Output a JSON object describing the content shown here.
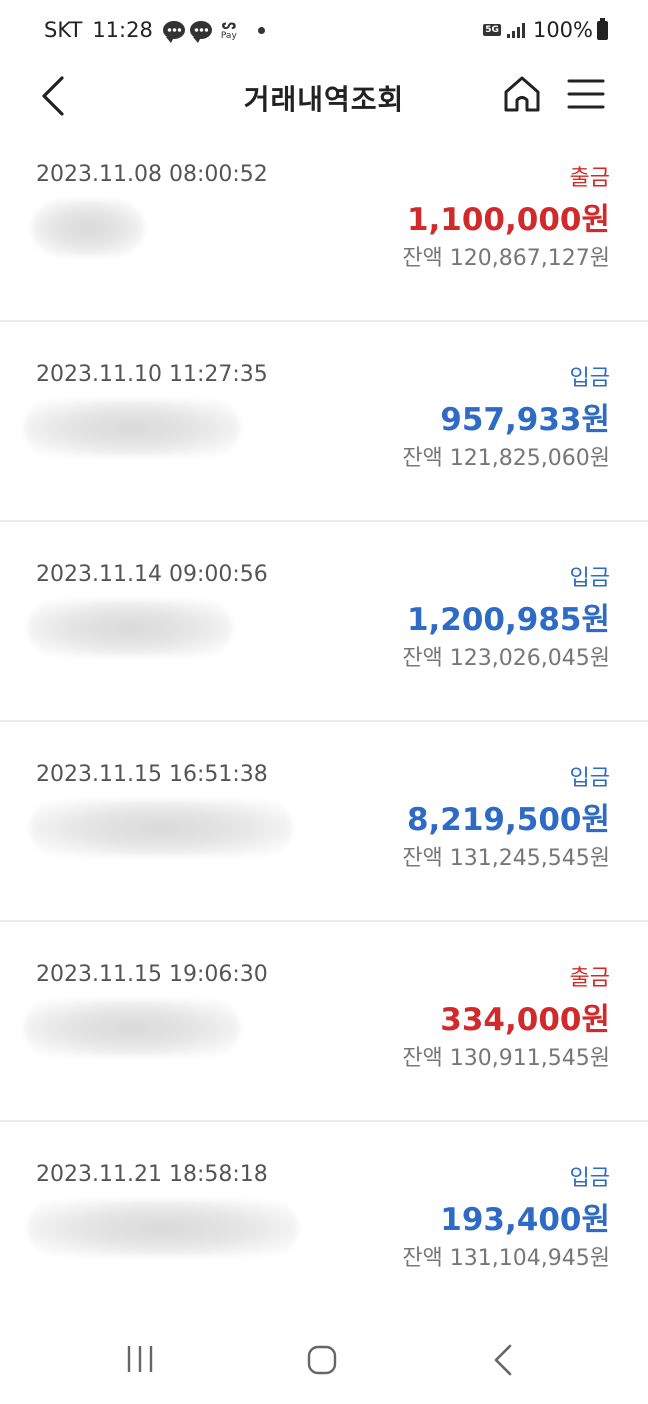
{
  "status_bar": {
    "carrier": "SKT",
    "time": "11:28",
    "pay_label": "Pay",
    "network": "5G",
    "battery": "100%"
  },
  "header": {
    "title": "거래내역조회"
  },
  "icons": {
    "back": "chevron-left-icon",
    "home": "home-icon",
    "menu": "hamburger-menu-icon"
  },
  "colors": {
    "withdrawal": "#d22a2a",
    "deposit": "#2e6bc4"
  },
  "transactions": [
    {
      "datetime": "2023.11.08 08:00:52",
      "type": "출금",
      "amount": "1,100,000원",
      "balance": "잔액 120,867,127원"
    },
    {
      "datetime": "2023.11.10 11:27:35",
      "type": "입금",
      "amount": "957,933원",
      "balance": "잔액 121,825,060원"
    },
    {
      "datetime": "2023.11.14 09:00:56",
      "type": "입금",
      "amount": "1,200,985원",
      "balance": "잔액 123,026,045원"
    },
    {
      "datetime": "2023.11.15 16:51:38",
      "type": "입금",
      "amount": "8,219,500원",
      "balance": "잔액 131,245,545원"
    },
    {
      "datetime": "2023.11.15 19:06:30",
      "type": "출금",
      "amount": "334,000원",
      "balance": "잔액 130,911,545원"
    },
    {
      "datetime": "2023.11.21 18:58:18",
      "type": "입금",
      "amount": "193,400원",
      "balance": "잔액 131,104,945원"
    }
  ]
}
